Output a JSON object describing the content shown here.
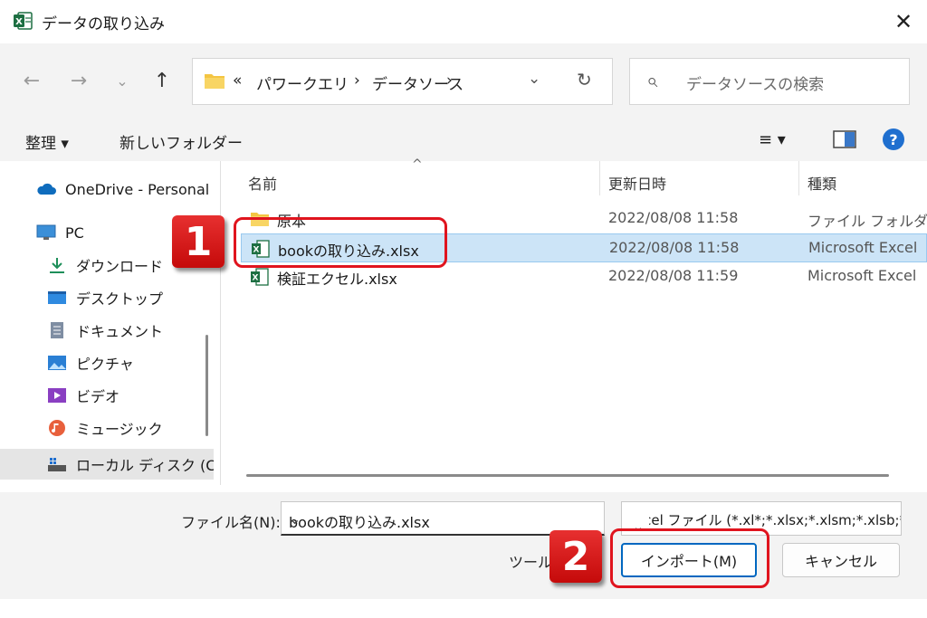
{
  "window": {
    "title": "データの取り込み",
    "close_glyph": "✕"
  },
  "nav": {
    "back_glyph": "←",
    "forward_glyph": "→",
    "recent_glyph": "⌄",
    "up_glyph": "↑"
  },
  "address": {
    "overflow": "«",
    "segments": [
      "パワークエリ",
      "データソース"
    ],
    "sep": "›",
    "dropdown_glyph": "⌄",
    "refresh_glyph": "↻"
  },
  "search": {
    "placeholder": "データソースの検索"
  },
  "toolbar": {
    "organize": "整理 ▾",
    "new_folder": "新しいフォルダー",
    "view_glyph": "≡ ▾",
    "help": "?"
  },
  "sidebar": {
    "items": [
      {
        "label": "OneDrive - Personal",
        "icon": "cloud-icon"
      },
      {
        "label": "PC",
        "icon": "monitor-icon"
      },
      {
        "label": "ダウンロード",
        "icon": "download-icon"
      },
      {
        "label": "デスクトップ",
        "icon": "desktop-icon"
      },
      {
        "label": "ドキュメント",
        "icon": "document-icon"
      },
      {
        "label": "ピクチャ",
        "icon": "picture-icon"
      },
      {
        "label": "ビデオ",
        "icon": "video-icon"
      },
      {
        "label": "ミュージック",
        "icon": "music-icon"
      },
      {
        "label": "ローカル ディスク (C:)",
        "icon": "drive-icon"
      }
    ]
  },
  "files": {
    "columns": {
      "name": "名前",
      "modified": "更新日時",
      "type": "種類",
      "sort_glyph": "^"
    },
    "rows": [
      {
        "name": "原本",
        "modified": "2022/08/08 11:58",
        "type": "ファイル フォルダー",
        "icon": "folder-icon"
      },
      {
        "name": "bookの取り込み.xlsx",
        "modified": "2022/08/08 11:58",
        "type": "Microsoft Excel",
        "icon": "excel-icon"
      },
      {
        "name": "検証エクセル.xlsx",
        "modified": "2022/08/08 11:59",
        "type": "Microsoft Excel",
        "icon": "excel-icon"
      }
    ]
  },
  "bottom": {
    "filename_label": "ファイル名(N):",
    "filename_value": "bookの取り込み.xlsx",
    "dropdown_glyph": "⌄",
    "filetype_value": "Excel ファイル (*.xl*;*.xlsx;*.xlsm;*.xlsb;*.xlam;*.xltx;*.xltm;*.xls;*.xla;*.xlt;*.xlm;*.xlw)",
    "tools_label": "ツール",
    "import_button": "インポート(M)",
    "cancel_button": "キャンセル"
  },
  "annotations": {
    "step1": "1",
    "step2": "2",
    "highlight_color": "#e0141e"
  }
}
